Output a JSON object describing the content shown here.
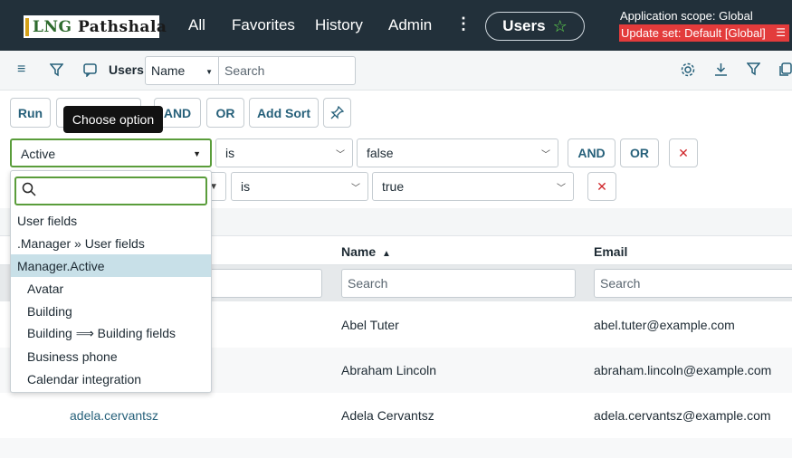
{
  "header": {
    "logo_text_a": "LNG ",
    "logo_text_b": "Pathshala",
    "nav": [
      "All",
      "Favorites",
      "History",
      "Admin"
    ],
    "more_label": "⋮",
    "current_app": "Users",
    "scope_label": "Application scope: Global",
    "update_set_label": "Update set: Default [Global]"
  },
  "toolbar": {
    "title": "Users",
    "field_select": "Name",
    "search_placeholder": "Search"
  },
  "condition_builder": {
    "run_label": "Run",
    "and_label": "AND",
    "or_label": "OR",
    "add_sort_label": "Add Sort",
    "tooltip": "Choose option",
    "row1": {
      "field": "Active",
      "operator": "is",
      "value": "false",
      "and_label": "AND",
      "or_label": "OR"
    },
    "row2": {
      "operator": "is",
      "value": "true"
    }
  },
  "field_dropdown": {
    "search_value": "",
    "items": [
      {
        "label": "User fields",
        "indent": false,
        "highlighted": false
      },
      {
        "label": ".Manager » User fields",
        "indent": false,
        "highlighted": false
      },
      {
        "label": "Manager.Active",
        "indent": false,
        "highlighted": true
      },
      {
        "label": "Avatar",
        "indent": true,
        "highlighted": false
      },
      {
        "label": "Building",
        "indent": true,
        "highlighted": false
      },
      {
        "label": "Building ⟹ Building fields",
        "indent": true,
        "highlighted": false
      },
      {
        "label": "Business phone",
        "indent": true,
        "highlighted": false
      },
      {
        "label": "Calendar integration",
        "indent": true,
        "highlighted": false
      }
    ]
  },
  "table": {
    "columns": [
      {
        "label": "Name",
        "sort": "▲"
      },
      {
        "label": "Email",
        "sort": ""
      }
    ],
    "search_placeholder": "Search",
    "rows": [
      {
        "user_id": "",
        "name": "Abel Tuter",
        "email": "abel.tuter@example.com"
      },
      {
        "user_id": "",
        "name": "Abraham Lincoln",
        "email": "abraham.lincoln@example.com"
      },
      {
        "user_id": "adela.cervantsz",
        "name": "Adela Cervantsz",
        "email": "adela.cervantsz@example.com"
      }
    ]
  },
  "colors": {
    "topbar": "#22303a",
    "update_set": "#e33b3b",
    "accent": "#26607a",
    "focus_green": "#5a9d3b",
    "remove_red": "#d0282c"
  }
}
